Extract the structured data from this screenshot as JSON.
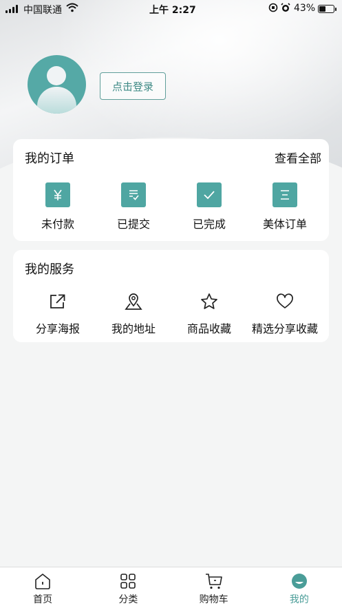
{
  "status_bar": {
    "carrier": "中国联通",
    "time": "上午 2:27",
    "battery_percent": "43%",
    "battery_level": 0.43
  },
  "profile": {
    "login_label": "点击登录"
  },
  "orders": {
    "title": "我的订单",
    "view_all": "查看全部",
    "items": [
      {
        "label": "未付款",
        "icon": "yen-icon"
      },
      {
        "label": "已提交",
        "icon": "submitted-list-icon"
      },
      {
        "label": "已完成",
        "icon": "checkmark-icon"
      },
      {
        "label": "美体订单",
        "icon": "list-lines-icon"
      }
    ]
  },
  "services": {
    "title": "我的服务",
    "items": [
      {
        "label": "分享海报",
        "icon": "share-icon"
      },
      {
        "label": "我的地址",
        "icon": "location-pin-icon"
      },
      {
        "label": "商品收藏",
        "icon": "star-icon"
      },
      {
        "label": "精选分享收藏",
        "icon": "heart-icon"
      }
    ]
  },
  "tabbar": {
    "items": [
      {
        "label": "首页",
        "icon": "home-icon"
      },
      {
        "label": "分类",
        "icon": "grid-icon"
      },
      {
        "label": "购物车",
        "icon": "cart-icon"
      },
      {
        "label": "我的",
        "icon": "profile-icon"
      }
    ],
    "active_index": 3
  },
  "colors": {
    "accent": "#4fa6a2",
    "active_tab": "#4a9d98",
    "background": "#f4f5f5"
  }
}
